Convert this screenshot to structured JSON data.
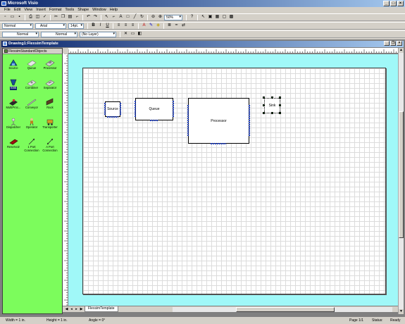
{
  "window": {
    "title": "Microsoft Visio"
  },
  "menu": [
    "File",
    "Edit",
    "View",
    "Insert",
    "Format",
    "Tools",
    "Shape",
    "Window",
    "Help"
  ],
  "toolbar": {
    "zoom": "50%",
    "style": "Normal",
    "font": "Arial",
    "font_size": "14pt.",
    "line_style": "Normal",
    "fill_style": "Normal",
    "layer": "(No Layer)",
    "bold": "B",
    "italic": "I",
    "underline": "U"
  },
  "document": {
    "title": "Drawing1:FlexsimTemplate"
  },
  "stencil": {
    "title": "FlexsimStandardObjects",
    "items": [
      {
        "label": "Source",
        "icon": "source-icon"
      },
      {
        "label": "Queue",
        "icon": "queue-icon"
      },
      {
        "label": "Processor",
        "icon": "processor-icon"
      },
      {
        "label": "Sink",
        "icon": "sink-icon"
      },
      {
        "label": "Combiner",
        "icon": "combiner-icon"
      },
      {
        "label": "Separator",
        "icon": "separator-icon"
      },
      {
        "label": "MultiProc...",
        "icon": "multiprocessor-icon"
      },
      {
        "label": "Conveyor",
        "icon": "conveyor-icon"
      },
      {
        "label": "Rack",
        "icon": "rack-icon"
      },
      {
        "label": "Dispatcher",
        "icon": "dispatcher-icon"
      },
      {
        "label": "Operator",
        "icon": "operator-icon"
      },
      {
        "label": "Transporter",
        "icon": "transporter-icon"
      },
      {
        "label": "Reservoir",
        "icon": "reservoir-icon"
      },
      {
        "label": "1 Port\nConnection",
        "icon": "one-port-connection-icon"
      },
      {
        "label": "A Port\nConnection",
        "icon": "a-port-connection-icon"
      }
    ]
  },
  "diagram": {
    "source": "Source",
    "queue": "Queue",
    "processor": "Processor",
    "sink": "Sink"
  },
  "page_tab": "FlexsimTemplate",
  "status": {
    "width": "Width = 1 in.",
    "height": "Height = 1 in.",
    "angle": "Angle = 0°",
    "page": "Page 1/1",
    "status": "Status:",
    "ready": "Ready"
  }
}
